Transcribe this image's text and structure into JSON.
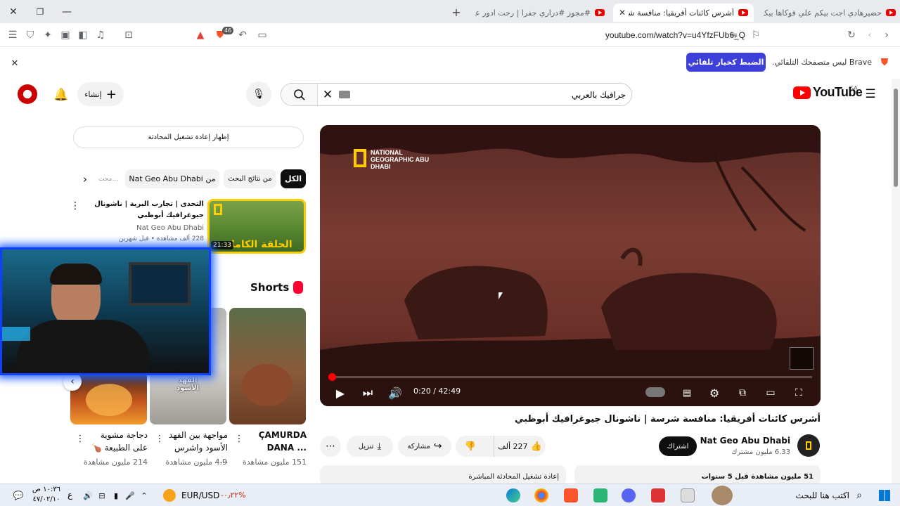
{
  "browser": {
    "tabs": [
      {
        "title": "حضيرهادي اجت بيكم علي فوكاها بيكم..."
      },
      {
        "title": "أشرس كائنات أفريقيا: منافسة شرسة..."
      },
      {
        "title": "#مجوز #دراري جفرا | رحت ادور عليها و..."
      }
    ],
    "url": "youtube.com/watch?v=u4YfzFUb6_Q",
    "shields_badge": "46"
  },
  "notice": {
    "text": "Brave ليس متصفحك التلقائي.",
    "button_label": "الضبط كخيار تلقائي"
  },
  "header": {
    "logo_text": "YouTube",
    "region": "SA",
    "search_value": "جرافيك بالعربي",
    "create_label": "إنشاء"
  },
  "video": {
    "title": "أشرس كائنات أفريقيا: منافسة شرسة | ناشونال جيوغرافيك أبوظبي",
    "time": "0:20 / 42:49",
    "progress": 0.0078,
    "watermark": "NATIONAL GEOGRAPHIC ABU DHABI",
    "channel_name": "Nat Geo Abu Dhabi",
    "subscribers": "6.33 مليون مشترك",
    "subscribe_label": "اشتراك",
    "likes": "227 ألف",
    "share_label": "مشاركة",
    "download_label": "تنزيل",
    "stats": "51 مليون مشاهدة  قبل 5 سنوات",
    "live_chat_replay": "إعادة تشغيل المحادثة المباشرة"
  },
  "sidebar": {
    "show_chat_replay": "إظهار إعادة تشغيل المحادثة",
    "chips": [
      "الكل",
      "من نتائج البحث",
      "من Nat Geo Abu Dhabi",
      "محت..."
    ],
    "related": {
      "title": "التحدى | تجارب البرية | ناشونال جيوغرافيك أبوظبي",
      "channel": "Nat Geo Abu Dhabi",
      "meta": "228 ألف مشاهدة • قبل شهرين",
      "duration": "21:33",
      "thumb_text": "الحلقة الكاملة"
    },
    "shorts_heading": "Shorts",
    "shorts": [
      {
        "title": "ÇAMURDA DANA ...",
        "views": "151 مليون مشاهدة"
      },
      {
        "title": "مواجهة بين الفهد الأسود واشرس ...",
        "views": "4.9 مليون مشاهدة",
        "overlay": "الفهد الأسود"
      },
      {
        "title": "دجاجة مشوية على الطبيعة 🍗",
        "views": "214 مليون مشاهدة"
      }
    ]
  },
  "taskbar": {
    "search_placeholder": "اكتب هنا للبحث",
    "ticker": "EUR/USD",
    "ticker_change": "-٠٫٢٢%",
    "lang": "ع",
    "time": "١٠:٣٦ ص",
    "date": "٤٧/٠٢/١٠"
  },
  "colors": {
    "brand_red": "#ff0000",
    "brave_blue": "#3c3fd9",
    "natgeo_yellow": "#ffce00"
  }
}
